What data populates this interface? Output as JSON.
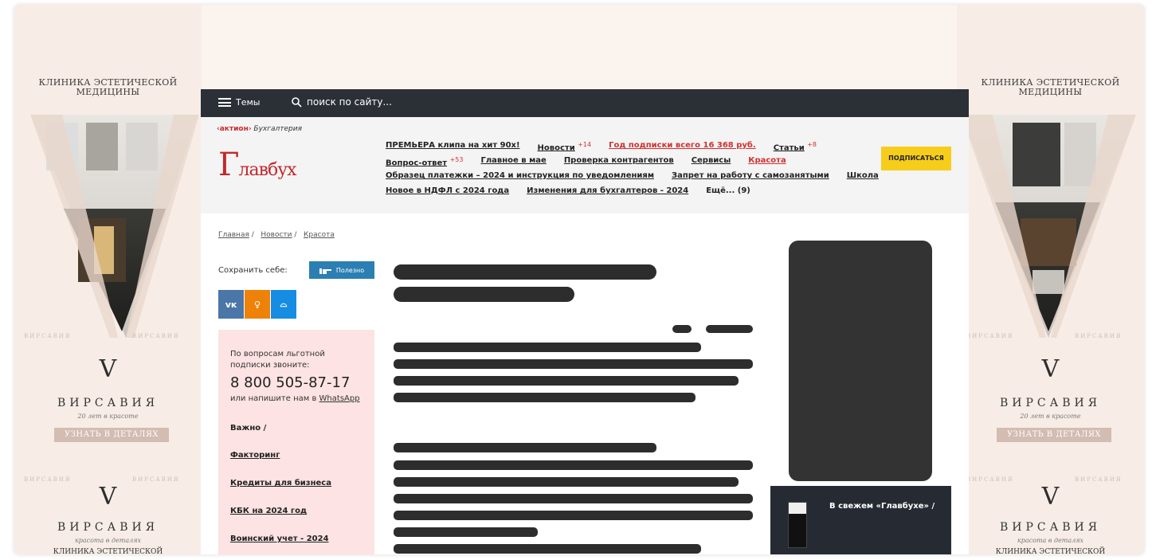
{
  "ad_banner": {
    "title_line1": "КЛИНИКА ЭСТЕТИЧЕСКОЙ",
    "title_line2": "МЕДИЦИНЫ",
    "brand": "ВИРСАВИЯ",
    "tagline1": "20 лет в красоте",
    "tagline2": "красота в деталях",
    "cta": "УЗНАТЬ В ДЕТАЛЯХ",
    "faint_brand": "ВИРСАВИЯ",
    "bottom_text": "КЛИНИКА ЭСТЕТИЧЕСКОЙ"
  },
  "topbar": {
    "menu_label": "Темы",
    "search_placeholder": "поиск по сайту..."
  },
  "header": {
    "aktion_brand": "‹актион›",
    "aktion_product": "Бухгалтерия",
    "logo_text": "лавбух",
    "logo_initial": "Г",
    "subscribe_label": "ПОДПИСАТЬСЯ"
  },
  "nav": {
    "row1": [
      {
        "label": "ПРЕМЬЕРА клипа на хит 90х!"
      },
      {
        "label": "Новости",
        "badge": "+14"
      },
      {
        "label": "Год подписки всего 16 368 руб.",
        "red": true
      },
      {
        "label": "Статьи",
        "badge": "+8"
      }
    ],
    "row2": [
      {
        "label": "Вопрос-ответ",
        "badge": "+53"
      },
      {
        "label": "Главное в мае"
      },
      {
        "label": "Проверка контрагентов"
      },
      {
        "label": "Сервисы"
      },
      {
        "label": "Красота",
        "red": true
      }
    ],
    "row3": [
      {
        "label": "Образец платежки – 2024 и инструкция по уведомлениям"
      },
      {
        "label": "Запрет на работу с самозанятыми"
      },
      {
        "label": "Школа"
      }
    ],
    "row4": [
      {
        "label": "Новое в НДФЛ с 2024 года"
      },
      {
        "label": "Изменения для бухгалтеров - 2024"
      },
      {
        "label": "Ещё... (9)"
      }
    ]
  },
  "breadcrumb": {
    "home": "Главная",
    "news": "Новости",
    "current": "Красота",
    "sep": "/"
  },
  "share": {
    "save_label": "Сохранить себе:",
    "useful_label": "Полезно",
    "vk": "vk",
    "ok": "ok",
    "mm": "mm",
    "vk_color": "#4a76a8",
    "ok_color": "#ee8208",
    "mm_color": "#168de2"
  },
  "promo": {
    "text1": "По вопросам льготной подписки звоните:",
    "phone": "8 800 505-87-17",
    "text2": "или напишите нам в",
    "whatsapp": "WhatsApp",
    "links": [
      "Важно  /",
      "Факторинг",
      "Кредиты для бизнеса",
      "КБК на 2024 год",
      "Воинский учет - 2024"
    ]
  },
  "fresh": {
    "label": "В свежем «Главбухе»  /"
  }
}
